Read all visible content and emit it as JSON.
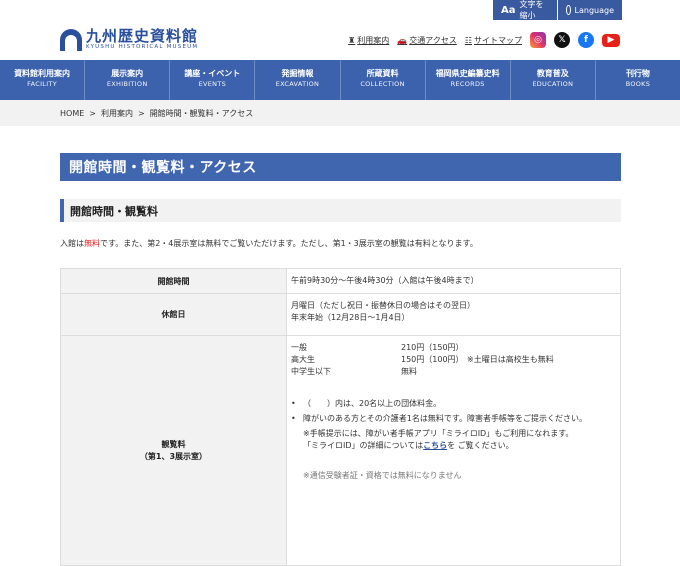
{
  "topbar": {
    "font_size_label": "文字を縮小",
    "font_size_icon": "Aa",
    "language_label": "Language"
  },
  "logo": {
    "jp": "九州歴史資料館",
    "en": "KYUSHU HISTORICAL MUSEUM"
  },
  "util_links": [
    {
      "icon": "map-pin-icon",
      "glyph": "♜",
      "label": "利用案内"
    },
    {
      "icon": "car-icon",
      "glyph": "🚗",
      "label": "交通アクセス"
    },
    {
      "icon": "sitemap-icon",
      "glyph": "☷",
      "label": "サイトマップ"
    }
  ],
  "sns": [
    {
      "name": "instagram-icon",
      "glyph": "◎"
    },
    {
      "name": "x-icon",
      "glyph": "𝕏"
    },
    {
      "name": "facebook-icon",
      "glyph": "f"
    },
    {
      "name": "youtube-icon",
      "glyph": "▶"
    }
  ],
  "gnav": [
    {
      "jp": "資料館利用案内",
      "en": "FACILITY"
    },
    {
      "jp": "展示案内",
      "en": "EXHIBITION"
    },
    {
      "jp": "講座・イベント",
      "en": "EVENTS"
    },
    {
      "jp": "発掘情報",
      "en": "EXCAVATION"
    },
    {
      "jp": "所蔵資料",
      "en": "COLLECTION"
    },
    {
      "jp": "福岡県史編纂史料",
      "en": "RECORDS"
    },
    {
      "jp": "教育普及",
      "en": "EDUCATION"
    },
    {
      "jp": "刊行物",
      "en": "BOOKS"
    }
  ],
  "breadcrumb": [
    "HOME",
    "利用案内",
    "開館時間・観覧料・アクセス"
  ],
  "breadcrumb_sep": ">",
  "page_title": "開館時間・観覧料・アクセス",
  "section_title": "開館時間・観覧料",
  "lead": {
    "pre": "入館は",
    "red": "無料",
    "post": "です。また、第2・4展示室は無料でご覧いただけます。ただし、第1・3展示室の観覧は有料となります。"
  },
  "table": {
    "hours": {
      "th": "開館時間",
      "td": "午前9時30分〜午後4時30分（入館は午後4時まで）"
    },
    "closed": {
      "th": "休館日",
      "td1": "月曜日（ただし祝日・振替休日の場合はその翌日）",
      "td2": "年末年始（12月28日〜1月4日）"
    },
    "fee": {
      "th1": "観覧料",
      "th2": "（第1、3展示室）",
      "rows": [
        {
          "label": "一般",
          "value": "210円（150円）",
          "note": ""
        },
        {
          "label": "高大生",
          "value": "150円（100円）",
          "note": "※土曜日は高校生も無料"
        },
        {
          "label": "中学生以下",
          "value": "無料",
          "note": ""
        }
      ],
      "note1": "（　　）内は、20名以上の団体料金。",
      "note2": "障がいのある方とその介護者1名は無料です。障害者手帳等をご提示ください。",
      "note3": "※手帳提示には、障がい者手帳アプリ「ミライロID」もご利用になれます。",
      "note4_pre": "「ミライロID」の詳細については",
      "note4_link": "こちら",
      "note4_post": "を ご覧ください。",
      "note5": "※通信受験者証・資格では無料になりません"
    }
  }
}
